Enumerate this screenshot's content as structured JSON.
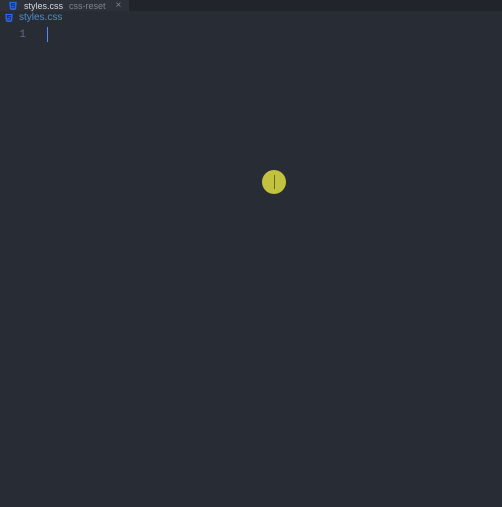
{
  "tab": {
    "filename": "styles.css",
    "subtitle": "css-reset",
    "icon": "css-file-icon"
  },
  "breadcrumb": {
    "filename": "styles.css",
    "icon": "css-file-icon"
  },
  "editor": {
    "lineNumbers": [
      "1"
    ],
    "content": ""
  },
  "colors": {
    "background": "#282c34",
    "tabBar": "#21252b",
    "activeTab": "#2c313a",
    "lineNumber": "#636d83",
    "breadcrumbLink": "#4f8fcc",
    "cursor": "#528bff",
    "cssIcon": "#2965f1"
  }
}
